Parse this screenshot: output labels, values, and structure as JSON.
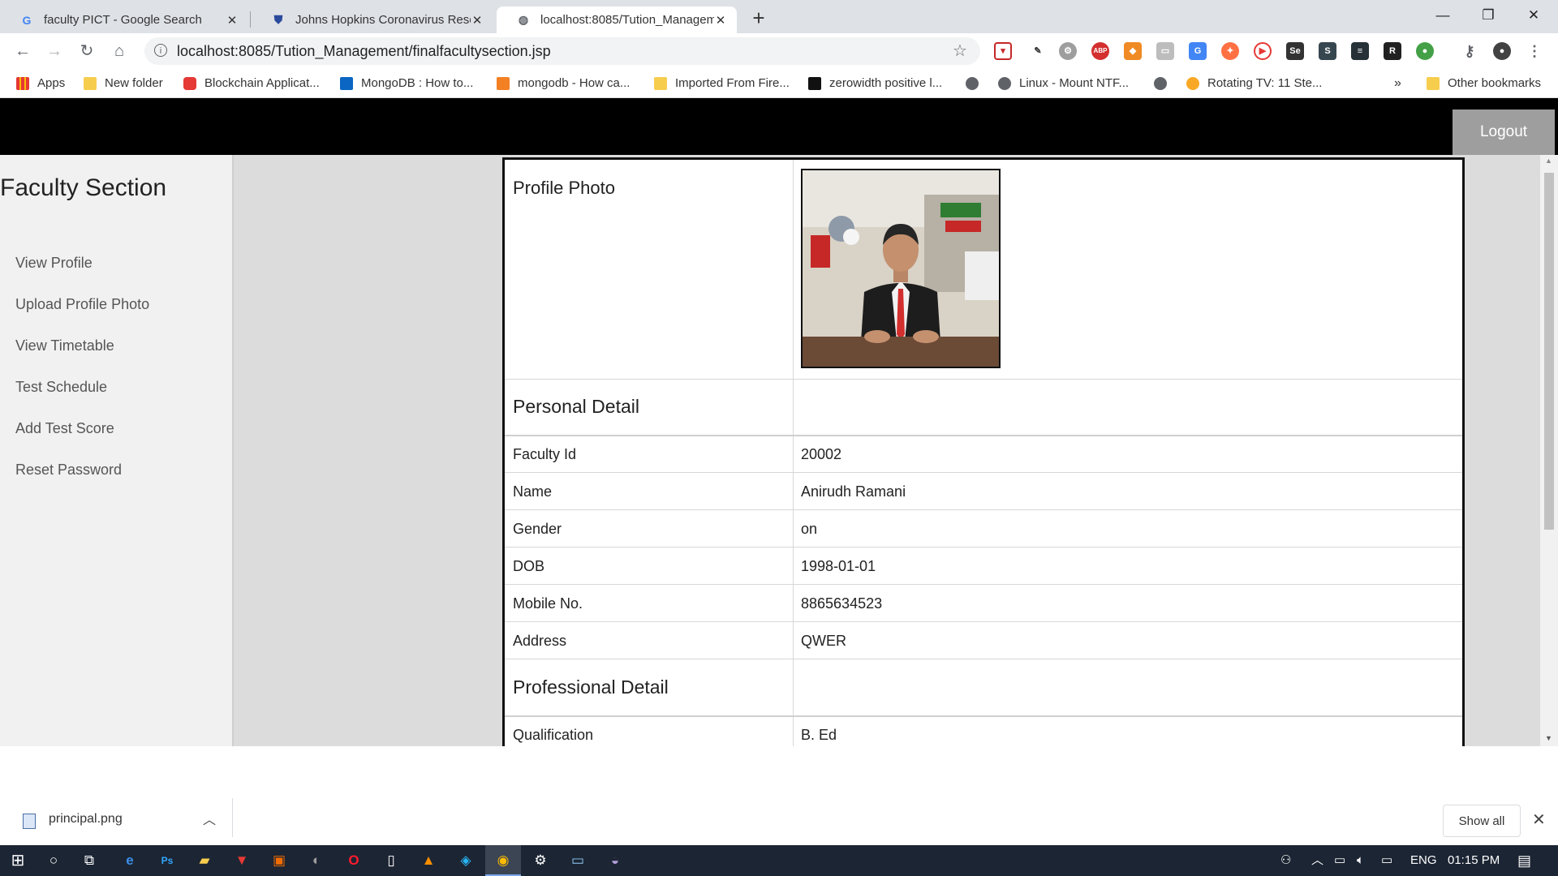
{
  "browser": {
    "tabs": [
      {
        "title": "faculty PICT - Google Search",
        "icon": "google-icon"
      },
      {
        "title": "Johns Hopkins Coronavirus Reso",
        "icon": "shield-icon"
      },
      {
        "title": "localhost:8085/Tution_Managem",
        "icon": "globe-icon"
      }
    ],
    "url": "localhost:8085/Tution_Management/finalfacultysection.jsp",
    "bookmarks": [
      {
        "label": "Apps",
        "icon": "apps-grid-icon"
      },
      {
        "label": "New folder",
        "icon": "folder-icon"
      },
      {
        "label": "Blockchain Applicat...",
        "icon": "youtube-icon"
      },
      {
        "label": "MongoDB : How to...",
        "icon": "linkedin-icon"
      },
      {
        "label": "mongodb - How ca...",
        "icon": "stackoverflow-icon"
      },
      {
        "label": "Imported From Fire...",
        "icon": "folder-icon"
      },
      {
        "label": "zerowidth positive l...",
        "icon": "terminal-icon"
      },
      {
        "label": "",
        "icon": "globe-icon"
      },
      {
        "label": "Linux - Mount NTF...",
        "icon": "globe-icon"
      },
      {
        "label": "",
        "icon": "globe-icon"
      },
      {
        "label": "Rotating TV: 11 Ste...",
        "icon": "instructables-icon"
      }
    ],
    "overflow_label": "»",
    "other_bookmarks": "Other bookmarks"
  },
  "site": {
    "logout_label": "Logout"
  },
  "sidebar": {
    "title": "Faculty Section",
    "links": [
      "View Profile",
      "Upload Profile Photo",
      "View Timetable",
      "Test Schedule",
      "Add Test Score",
      "Reset Password"
    ]
  },
  "profile": {
    "photo_label": "Profile Photo",
    "personal_heading": "Personal Detail",
    "fields": [
      {
        "label": "Faculty Id",
        "value": "20002"
      },
      {
        "label": "Name",
        "value": "Anirudh Ramani"
      },
      {
        "label": "Gender",
        "value": "on"
      },
      {
        "label": "DOB",
        "value": "1998-01-01"
      },
      {
        "label": "Mobile No.",
        "value": "8865634523"
      },
      {
        "label": "Address",
        "value": "QWER"
      }
    ],
    "professional_heading": "Professional Detail",
    "professional_fields": [
      {
        "label": "Qualification",
        "value": "B. Ed"
      }
    ]
  },
  "downloads": {
    "file_name": "principal.png",
    "show_all_label": "Show all"
  },
  "taskbar": {
    "language": "ENG",
    "time": "01:15 PM"
  },
  "colors": {
    "header_bg": "#000000",
    "logout_bg": "#9e9e9e",
    "sidebar_bg": "#f1f1f1",
    "content_bg": "#dcdcdc",
    "taskbar_bg": "#1c2533"
  }
}
